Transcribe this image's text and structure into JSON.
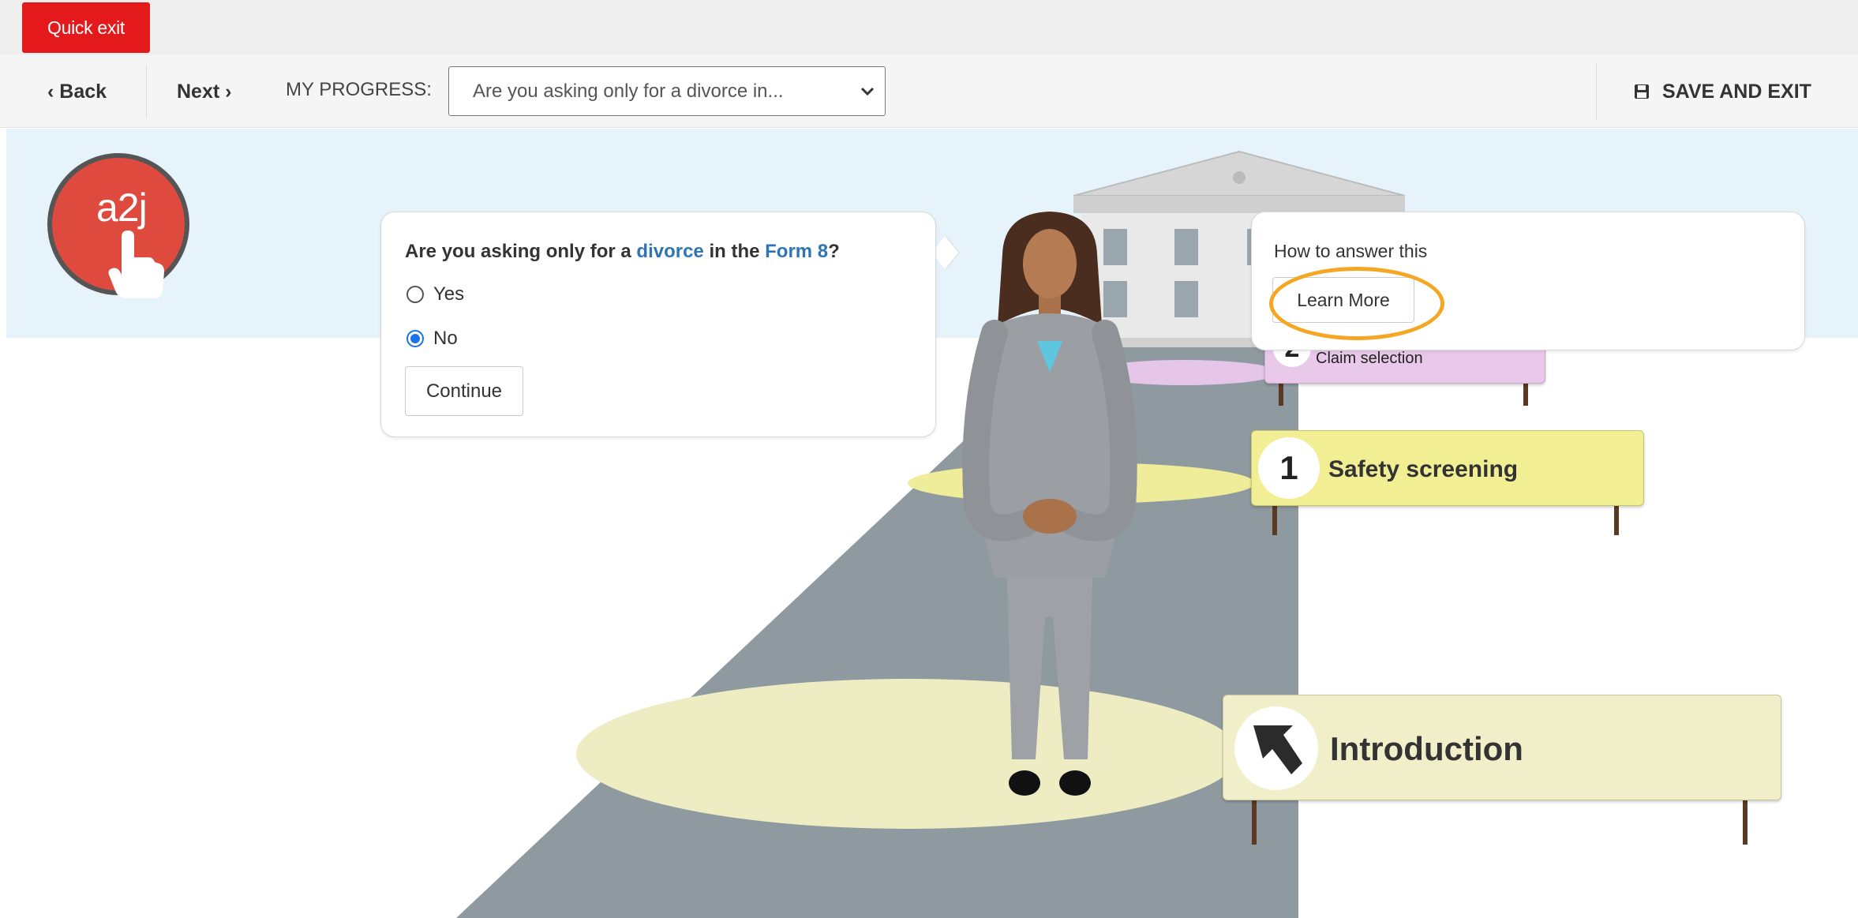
{
  "top_bar": {
    "quick_exit_label": "Quick exit"
  },
  "nav": {
    "back_label": "‹ Back",
    "next_label": "Next ›",
    "progress_label": "MY PROGRESS:",
    "progress_selected": "Are you asking only for a divorce in...",
    "save_exit_label": "SAVE AND EXIT"
  },
  "logo": {
    "text": "a2j"
  },
  "question": {
    "prefix": "Are you asking only for a ",
    "link1": "divorce",
    "middle": " in the ",
    "link2": "Form 8",
    "suffix": "?",
    "options": [
      {
        "label": "Yes",
        "checked": false
      },
      {
        "label": "No",
        "checked": true
      }
    ],
    "continue_label": "Continue"
  },
  "help": {
    "how_label": "How to answer this",
    "learn_more_label": "Learn More"
  },
  "steps": [
    {
      "number": "2",
      "label": "Claim selection"
    },
    {
      "number": "1",
      "label": "Safety screening"
    },
    {
      "number": "",
      "label": "Introduction"
    }
  ],
  "colors": {
    "quick_exit": "#e3191b",
    "logo": "#de4b3e",
    "link": "#2f74b5",
    "highlight": "#f5a623",
    "sky": "#e6f3fa",
    "path": "#8e9aa0"
  },
  "icons": [
    "chevron-down-icon",
    "save-icon",
    "pointer-hand-icon",
    "arrow-up-left-icon",
    "courthouse-icon"
  ]
}
